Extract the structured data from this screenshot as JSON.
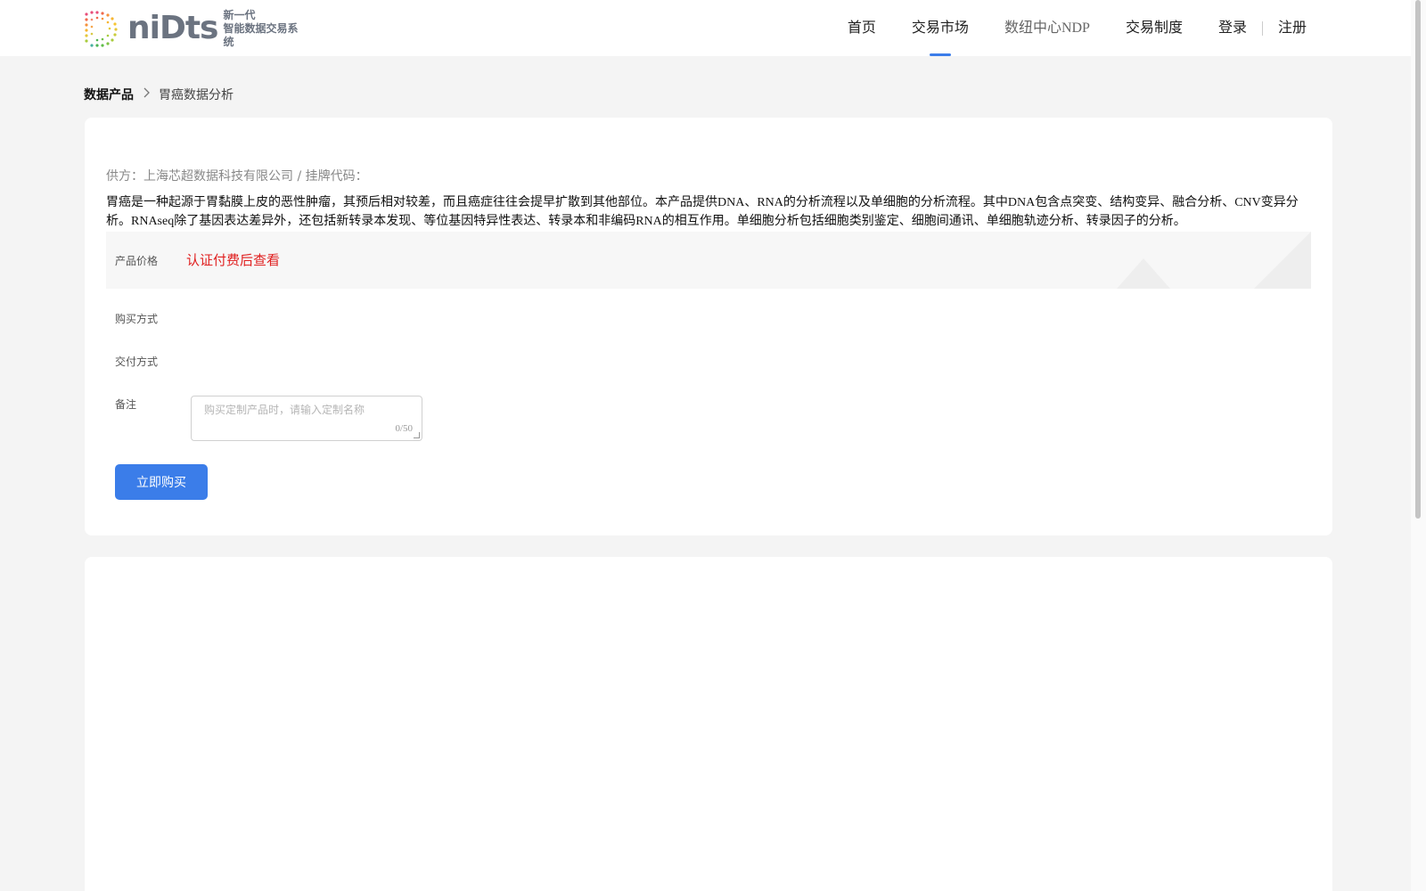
{
  "header": {
    "logo": {
      "word": "niDts",
      "tagline_1": "新一代",
      "tagline_2": "智能数据交易系统"
    },
    "nav": [
      {
        "label": "首页",
        "active": false
      },
      {
        "label": "交易市场",
        "active": true
      },
      {
        "label": "数纽中心NDP",
        "active": false
      },
      {
        "label": "交易制度",
        "active": false
      }
    ],
    "login_label": "登录",
    "register_label": "注册",
    "accent_color": "#3b7de9"
  },
  "breadcrumb": {
    "root": "数据产品",
    "current": "胃癌数据分析"
  },
  "product": {
    "supplier_line": "供方：上海芯超数据科技有限公司 / 挂牌代码：",
    "description": "胃癌是一种起源于胃黏膜上皮的恶性肿瘤，其预后相对较差，而且癌症往往会提早扩散到其他部位。本产品提供DNA、RNA的分析流程以及单细胞的分析流程。其中DNA包含点突变、结构变异、融合分析、CNV变异分析。RNAseq除了基因表达差异外，还包括新转录本发现、等位基因特异性表达、转录本和非编码RNA的相互作用。单细胞分析包括细胞类别鉴定、细胞间通讯、单细胞轨迹分析、转录因子的分析。",
    "price_label": "产品价格",
    "price_value": "认证付费后查看",
    "price_color": "#e02020",
    "buy_method_label": "购买方式",
    "delivery_label": "交付方式",
    "note_label": "备注",
    "note_placeholder": "购买定制产品时，请输入定制名称",
    "note_value": "",
    "note_counter": "0/50",
    "buy_button_label": "立即购买"
  }
}
